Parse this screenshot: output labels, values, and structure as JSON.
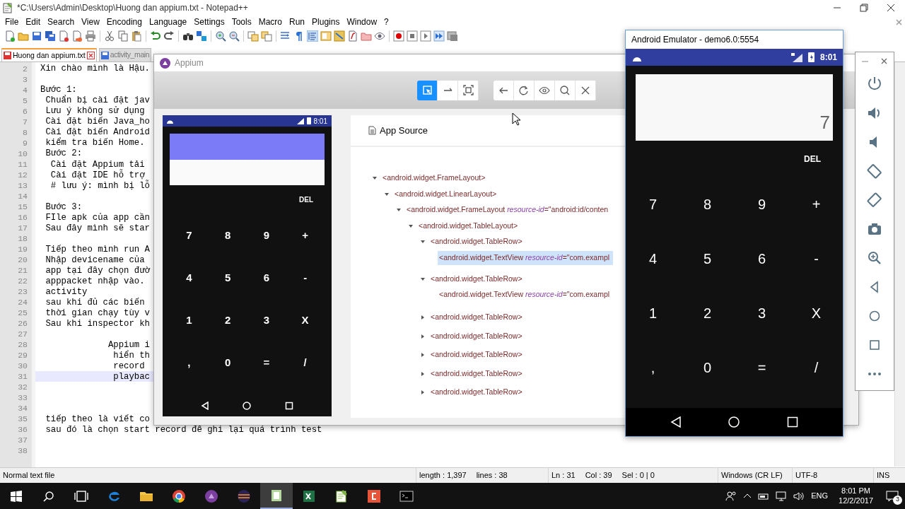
{
  "notepad": {
    "title": "*C:\\Users\\Admin\\Desktop\\Huong dan appium.txt - Notepad++",
    "menu": [
      "File",
      "Edit",
      "Search",
      "View",
      "Encoding",
      "Language",
      "Settings",
      "Tools",
      "Macro",
      "Run",
      "Plugins",
      "Window",
      "?"
    ],
    "tabs": [
      {
        "label": "Huong dan appium.txt",
        "selected": true
      },
      {
        "label": "activity_main",
        "selected": false
      }
    ],
    "lines": [
      {
        "number": "2",
        "text": "Xin chào mình là Hậu.",
        "current": false
      },
      {
        "number": "3",
        "current": false
      },
      {
        "number": "4",
        "text": "Bước 1:",
        "current": false
      },
      {
        "number": "5",
        "text": " Chuẩn bị cài đặt jav",
        "current": false
      },
      {
        "number": "6",
        "text": " Lưu ý không sử dụng",
        "current": false
      },
      {
        "number": "7",
        "text": " Cài đặt biến Java_ho",
        "current": false
      },
      {
        "number": "8",
        "text": " Cài đặt biến Android",
        "current": false
      },
      {
        "number": "9",
        "text": " kiểm tra biến Home.",
        "current": false
      },
      {
        "number": "10",
        "text": " Bước 2:",
        "current": false
      },
      {
        "number": "11",
        "text": "  Cài đặt Appium tải",
        "current": false
      },
      {
        "number": "12",
        "text": "  Cài đặt IDE hỗ trợ",
        "current": false
      },
      {
        "number": "13",
        "text": "  # lưu ý: mình bị lỗ",
        "current": false
      },
      {
        "number": "14",
        "current": false
      },
      {
        "number": "15",
        "text": " Bước 3:",
        "current": false
      },
      {
        "number": "16",
        "text": " FIle apk của app cần",
        "current": false
      },
      {
        "number": "17",
        "text": " Sau đây mình sẽ star",
        "current": false
      },
      {
        "number": "18",
        "current": false
      },
      {
        "number": "19",
        "text": " Tiếp theo mình run A",
        "current": false
      },
      {
        "number": "20",
        "text": " Nhập devicename của",
        "current": false
      },
      {
        "number": "21",
        "text": " app tại đây chọn đườ",
        "current": false
      },
      {
        "number": "22",
        "text": " apppacket nhập vào.",
        "current": false
      },
      {
        "number": "23",
        "text": " activity",
        "current": false
      },
      {
        "number": "24",
        "text": " sau khi đủ các biến",
        "current": false
      },
      {
        "number": "25",
        "text": " thời gian chạy tùy v",
        "current": false
      },
      {
        "number": "26",
        "text": " Sau khi inspector kh",
        "current": false
      },
      {
        "number": "27",
        "current": false
      },
      {
        "number": "28",
        "text": "             Appium i",
        "current": false
      },
      {
        "number": "29",
        "text": "              hiển th",
        "current": false
      },
      {
        "number": "30",
        "text": "              record",
        "current": false
      },
      {
        "number": "31",
        "text": "              playbac",
        "current": true
      },
      {
        "number": "32",
        "current": false
      },
      {
        "number": "33",
        "current": false
      },
      {
        "number": "34",
        "current": false
      },
      {
        "number": "35",
        "text": " tiếp theo là viết co",
        "current": false
      },
      {
        "number": "36",
        "text": " sau đó là chọn start record để ghi lại quá trình test",
        "current": false
      },
      {
        "number": "37",
        "current": false
      },
      {
        "number": "38",
        "current": false
      }
    ],
    "status_bar": {
      "file_type": "Normal text file",
      "length": "length : 1,397",
      "lines": "lines : 38",
      "ln": "Ln : 31",
      "col": "Col : 39",
      "sel": "Sel : 0 | 0",
      "eol": "Windows (CR LF)",
      "encoding": "UTF-8",
      "mode": "INS"
    }
  },
  "appium": {
    "title": "Appium",
    "mode_tools": [
      {
        "selected": true
      },
      {
        "selected": false
      },
      {
        "selected": false
      }
    ],
    "phone": {
      "time": "8:01",
      "del": "DEL",
      "keys": [
        "7",
        "8",
        "9",
        "+",
        "4",
        "5",
        "6",
        "-",
        "1",
        "2",
        "3",
        "X",
        ",",
        "0",
        "=",
        "/"
      ]
    },
    "source": {
      "title": "App Source",
      "tree": [
        {
          "label": "<android.widget.FrameLayout>",
          "expanded": true,
          "selected": false,
          "children": [
            {
              "label": "<android.widget.LinearLayout>",
              "expanded": true,
              "selected": false,
              "children": [
                {
                  "label": "<android.widget.FrameLayout *resource-id*=\"android:id/conten",
                  "expanded": true,
                  "selected": false,
                  "children": [
                    {
                      "label": "<android.widget.TableLayout>",
                      "expanded": true,
                      "selected": false,
                      "children": [
                        {
                          "label": "<android.widget.TableRow>",
                          "expanded": true,
                          "selected": false,
                          "children": [
                            {
                              "label": "<android.widget.TextView *resource-id*=\"com.exampl",
                              "selected": true
                            }
                          ]
                        },
                        {
                          "label": "<android.widget.TableRow>",
                          "expanded": true,
                          "selected": false,
                          "children": [
                            {
                              "label": "<android.widget.TextView *resource-id*=\"com.exampl",
                              "selected": false
                            }
                          ]
                        },
                        {
                          "label": "<android.widget.TableRow>",
                          "expanded": false,
                          "selected": false
                        },
                        {
                          "label": "<android.widget.TableRow>",
                          "expanded": false,
                          "selected": false
                        },
                        {
                          "label": "<android.widget.TableRow>",
                          "expanded": false,
                          "selected": false
                        },
                        {
                          "label": "<android.widget.TableRow>",
                          "expanded": false,
                          "selected": false
                        },
                        {
                          "label": "<android.widget.TableRow>",
                          "expanded": false,
                          "selected": false
                        }
                      ]
                    }
                  ]
                }
              ]
            }
          ]
        }
      ]
    }
  },
  "emulator": {
    "title": "Android Emulator - demo6.0:5554",
    "time": "8:01",
    "display": "7",
    "del": "DEL",
    "keys": [
      "7",
      "8",
      "9",
      "+",
      "4",
      "5",
      "6",
      "-",
      "1",
      "2",
      "3",
      "X",
      ",",
      "0",
      "=",
      "/"
    ]
  },
  "taskbar": {
    "apps": [
      {
        "selected": false
      },
      {
        "selected": false
      },
      {
        "selected": false
      },
      {
        "selected": false
      },
      {
        "selected": false
      },
      {
        "selected": false
      },
      {
        "selected": true
      },
      {
        "selected": false
      },
      {
        "selected": false
      },
      {
        "selected": false
      },
      {
        "selected": false
      }
    ],
    "language": "ENG",
    "time": "8:01 PM",
    "date": "12/2/2017",
    "notifications": "3"
  }
}
